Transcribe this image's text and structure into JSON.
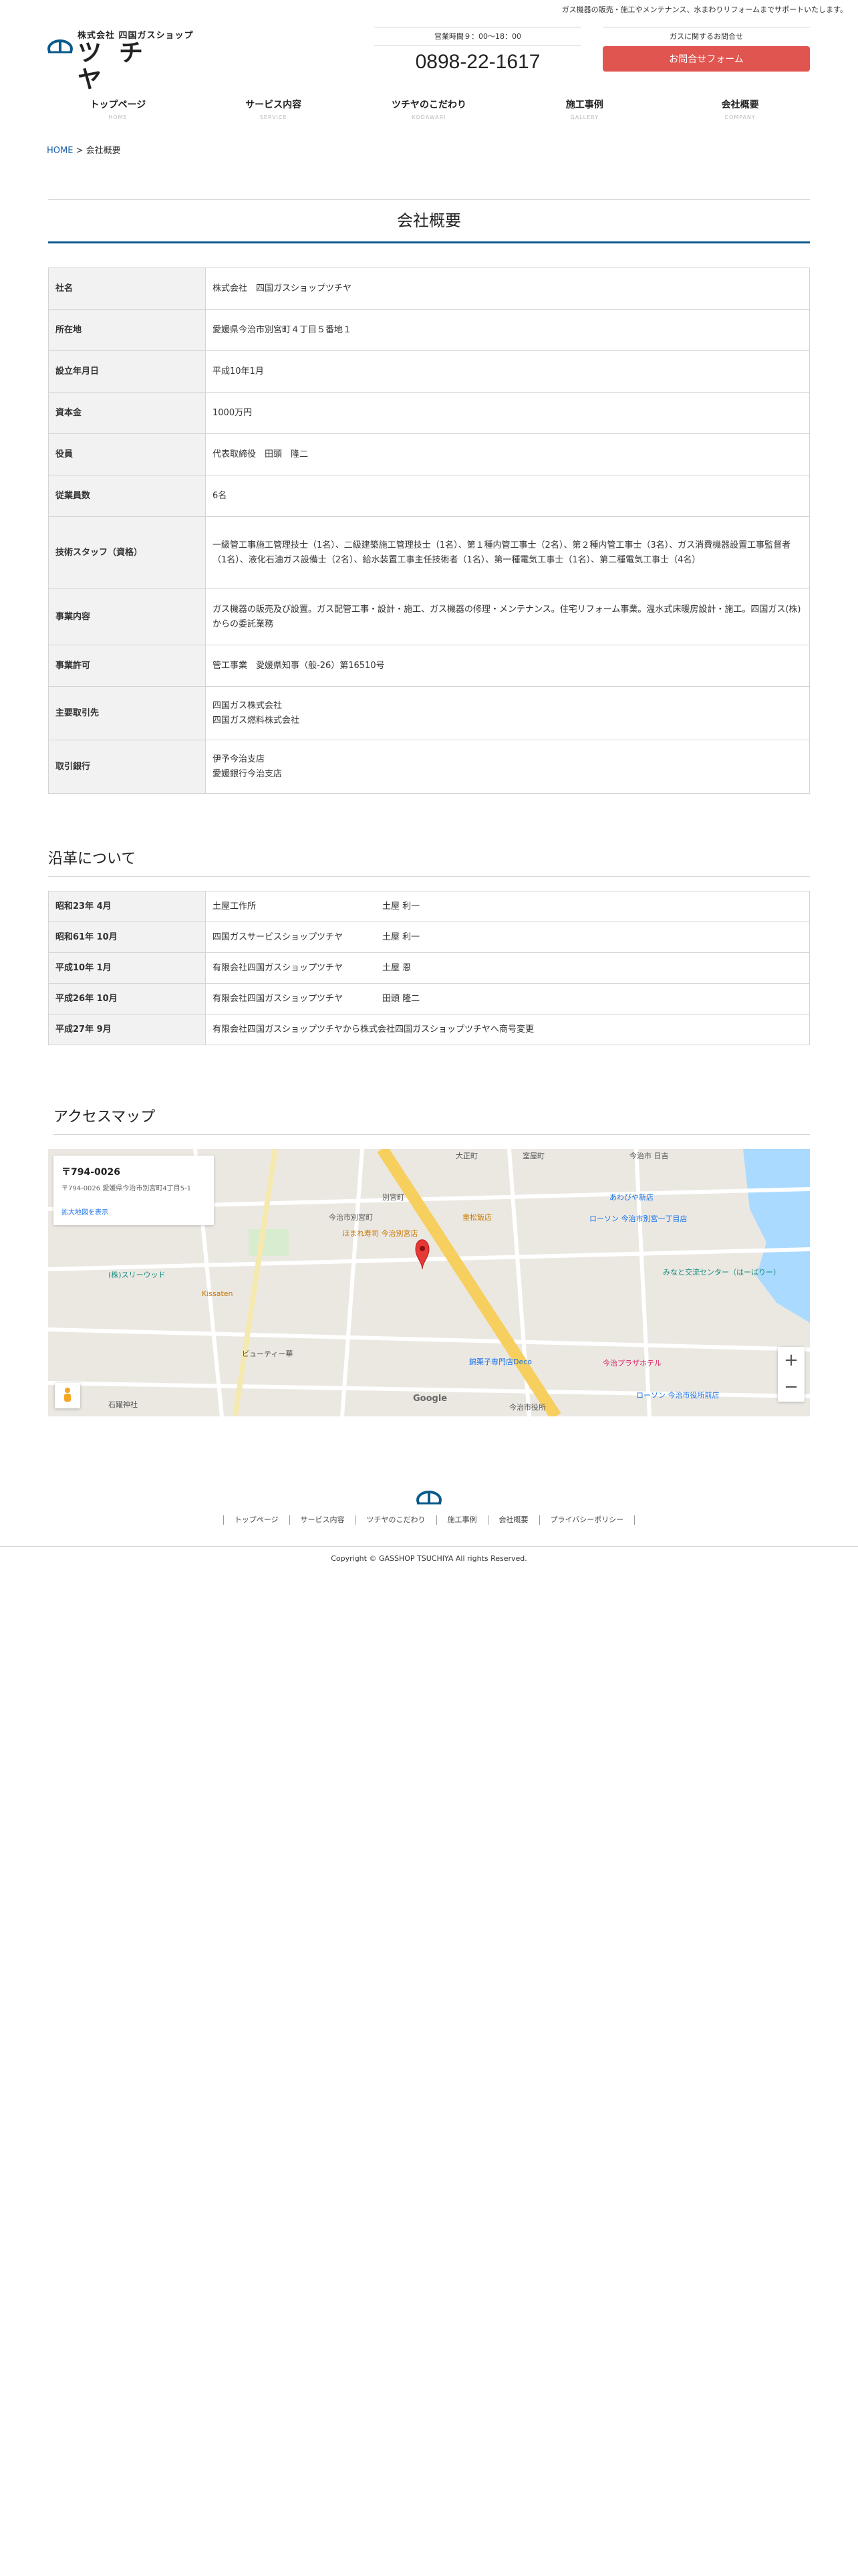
{
  "header": {
    "tagline": "ガス機器の販売・施工やメンテナンス、水まわりリフォームまでサポートいたします。",
    "logo_sub": "株式会社 四国ガスショップ",
    "logo_main": "ツチヤ",
    "hours_label": "営業時間９：00～18：00",
    "phone": "0898-22-1617",
    "contact_label": "ガスに関するお問合せ",
    "contact_button": "お問合せフォーム",
    "accent_color": "#e05550",
    "brand_color": "#0a5a8c"
  },
  "nav": [
    {
      "label": "トップページ",
      "sub": "HOME"
    },
    {
      "label": "サービス内容",
      "sub": "SERVICE"
    },
    {
      "label": "ツチヤのこだわり",
      "sub": "KODAWARI"
    },
    {
      "label": "施工事例",
      "sub": "GALLERY"
    },
    {
      "label": "会社概要",
      "sub": "COMPANY"
    }
  ],
  "breadcrumb": {
    "home": "HOME",
    "separator": " > ",
    "current": "会社概要"
  },
  "page_title": "会社概要",
  "company_table": [
    {
      "label": "社名",
      "value": "株式会社　四国ガスショップツチヤ"
    },
    {
      "label": "所在地",
      "value": "愛媛県今治市別宮町４丁目５番地１"
    },
    {
      "label": "設立年月日",
      "value": "平成10年1月"
    },
    {
      "label": "資本金",
      "value": "1000万円"
    },
    {
      "label": "役員",
      "value": "代表取締役　田頭　隆二"
    },
    {
      "label": "従業員数",
      "value": "6名"
    },
    {
      "label": "技術スタッフ（資格）",
      "value": "一級管工事施工管理技士（1名）、二級建築施工管理技士（1名）、第１種内管工事士（2名）、第２種内管工事士（3名）、ガス消費機器設置工事監督者（1名）、液化石油ガス設備士（2名）、給水装置工事主任技術者（1名）、第一種電気工事士（1名）、第二種電気工事士（4名）"
    },
    {
      "label": "事業内容",
      "value": "ガス機器の販売及び設置。ガス配管工事・設計・施工、ガス機器の修理・メンテナンス。住宅リフォーム事業。温水式床暖房設計・施工。四国ガス(株)からの委託業務"
    },
    {
      "label": "事業許可",
      "value": "管工事業　愛媛県知事（般-26）第16510号"
    },
    {
      "label": "主要取引先",
      "lines": [
        "四国ガス株式会社",
        "四国ガス燃料株式会社"
      ]
    },
    {
      "label": "取引銀行",
      "lines": [
        "伊予今治支店",
        "愛媛銀行今治支店"
      ]
    }
  ],
  "history_title": "沿革について",
  "history": [
    {
      "date": "昭和23年 4月",
      "name": "土屋工作所",
      "person": "土屋 利一"
    },
    {
      "date": "昭和61年 10月",
      "name": "四国ガスサービスショップツチヤ",
      "person": "土屋 利一"
    },
    {
      "date": "平成10年 1月",
      "name": "有限会社四国ガスショップツチヤ",
      "person": "土屋 恩"
    },
    {
      "date": "平成26年 10月",
      "name": "有限会社四国ガスショップツチヤ",
      "person": "田頭 隆二"
    },
    {
      "date": "平成27年 9月",
      "name": "有限会社四国ガスショップツチヤから株式会社四国ガスショップツチヤへ商号変更",
      "person": ""
    }
  ],
  "access_title": "アクセスマップ",
  "map": {
    "info_title": "〒794-0026",
    "info_addr": "〒794-0026 愛媛県今治市別宮町4丁目5-1",
    "info_link": "拡大地図を表示",
    "labels": [
      "大正町",
      "室屋町",
      "今治市 日吉",
      "別宮町",
      "今治市別宮町",
      "ほまれ寿司 今治別宮店",
      "重松飯店",
      "ローソン 今治市別宮一丁目店",
      "あわびや新店",
      "みなと交流センター（はーばりー）",
      "(株)スリーウッド",
      "Kissaten",
      "ビューティー華",
      "錦栗子専門店Deco",
      "今治プラザホテル",
      "ローソン 今治市役所前店",
      "今治市役所",
      "石躍神社",
      "Google"
    ],
    "zoom_in": "+",
    "zoom_out": "−"
  },
  "footer": {
    "nav": [
      "トップページ",
      "サービス内容",
      "ツチヤのこだわり",
      "施工事例",
      "会社概要",
      "プライバシーポリシー"
    ],
    "copyright": "Copyright © GASSHOP TSUCHIYA All rights Reserved."
  }
}
